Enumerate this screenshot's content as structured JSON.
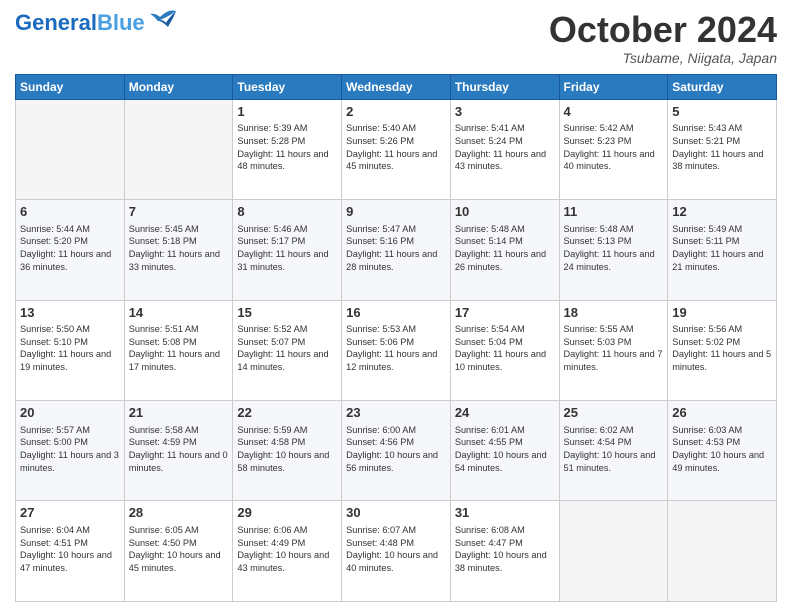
{
  "logo": {
    "part1": "General",
    "part2": "Blue"
  },
  "title": "October 2024",
  "subtitle": "Tsubame, Niigata, Japan",
  "weekdays": [
    "Sunday",
    "Monday",
    "Tuesday",
    "Wednesday",
    "Thursday",
    "Friday",
    "Saturday"
  ],
  "weeks": [
    [
      {
        "day": "",
        "text": ""
      },
      {
        "day": "",
        "text": ""
      },
      {
        "day": "1",
        "text": "Sunrise: 5:39 AM\nSunset: 5:28 PM\nDaylight: 11 hours and 48 minutes."
      },
      {
        "day": "2",
        "text": "Sunrise: 5:40 AM\nSunset: 5:26 PM\nDaylight: 11 hours and 45 minutes."
      },
      {
        "day": "3",
        "text": "Sunrise: 5:41 AM\nSunset: 5:24 PM\nDaylight: 11 hours and 43 minutes."
      },
      {
        "day": "4",
        "text": "Sunrise: 5:42 AM\nSunset: 5:23 PM\nDaylight: 11 hours and 40 minutes."
      },
      {
        "day": "5",
        "text": "Sunrise: 5:43 AM\nSunset: 5:21 PM\nDaylight: 11 hours and 38 minutes."
      }
    ],
    [
      {
        "day": "6",
        "text": "Sunrise: 5:44 AM\nSunset: 5:20 PM\nDaylight: 11 hours and 36 minutes."
      },
      {
        "day": "7",
        "text": "Sunrise: 5:45 AM\nSunset: 5:18 PM\nDaylight: 11 hours and 33 minutes."
      },
      {
        "day": "8",
        "text": "Sunrise: 5:46 AM\nSunset: 5:17 PM\nDaylight: 11 hours and 31 minutes."
      },
      {
        "day": "9",
        "text": "Sunrise: 5:47 AM\nSunset: 5:16 PM\nDaylight: 11 hours and 28 minutes."
      },
      {
        "day": "10",
        "text": "Sunrise: 5:48 AM\nSunset: 5:14 PM\nDaylight: 11 hours and 26 minutes."
      },
      {
        "day": "11",
        "text": "Sunrise: 5:48 AM\nSunset: 5:13 PM\nDaylight: 11 hours and 24 minutes."
      },
      {
        "day": "12",
        "text": "Sunrise: 5:49 AM\nSunset: 5:11 PM\nDaylight: 11 hours and 21 minutes."
      }
    ],
    [
      {
        "day": "13",
        "text": "Sunrise: 5:50 AM\nSunset: 5:10 PM\nDaylight: 11 hours and 19 minutes."
      },
      {
        "day": "14",
        "text": "Sunrise: 5:51 AM\nSunset: 5:08 PM\nDaylight: 11 hours and 17 minutes."
      },
      {
        "day": "15",
        "text": "Sunrise: 5:52 AM\nSunset: 5:07 PM\nDaylight: 11 hours and 14 minutes."
      },
      {
        "day": "16",
        "text": "Sunrise: 5:53 AM\nSunset: 5:06 PM\nDaylight: 11 hours and 12 minutes."
      },
      {
        "day": "17",
        "text": "Sunrise: 5:54 AM\nSunset: 5:04 PM\nDaylight: 11 hours and 10 minutes."
      },
      {
        "day": "18",
        "text": "Sunrise: 5:55 AM\nSunset: 5:03 PM\nDaylight: 11 hours and 7 minutes."
      },
      {
        "day": "19",
        "text": "Sunrise: 5:56 AM\nSunset: 5:02 PM\nDaylight: 11 hours and 5 minutes."
      }
    ],
    [
      {
        "day": "20",
        "text": "Sunrise: 5:57 AM\nSunset: 5:00 PM\nDaylight: 11 hours and 3 minutes."
      },
      {
        "day": "21",
        "text": "Sunrise: 5:58 AM\nSunset: 4:59 PM\nDaylight: 11 hours and 0 minutes."
      },
      {
        "day": "22",
        "text": "Sunrise: 5:59 AM\nSunset: 4:58 PM\nDaylight: 10 hours and 58 minutes."
      },
      {
        "day": "23",
        "text": "Sunrise: 6:00 AM\nSunset: 4:56 PM\nDaylight: 10 hours and 56 minutes."
      },
      {
        "day": "24",
        "text": "Sunrise: 6:01 AM\nSunset: 4:55 PM\nDaylight: 10 hours and 54 minutes."
      },
      {
        "day": "25",
        "text": "Sunrise: 6:02 AM\nSunset: 4:54 PM\nDaylight: 10 hours and 51 minutes."
      },
      {
        "day": "26",
        "text": "Sunrise: 6:03 AM\nSunset: 4:53 PM\nDaylight: 10 hours and 49 minutes."
      }
    ],
    [
      {
        "day": "27",
        "text": "Sunrise: 6:04 AM\nSunset: 4:51 PM\nDaylight: 10 hours and 47 minutes."
      },
      {
        "day": "28",
        "text": "Sunrise: 6:05 AM\nSunset: 4:50 PM\nDaylight: 10 hours and 45 minutes."
      },
      {
        "day": "29",
        "text": "Sunrise: 6:06 AM\nSunset: 4:49 PM\nDaylight: 10 hours and 43 minutes."
      },
      {
        "day": "30",
        "text": "Sunrise: 6:07 AM\nSunset: 4:48 PM\nDaylight: 10 hours and 40 minutes."
      },
      {
        "day": "31",
        "text": "Sunrise: 6:08 AM\nSunset: 4:47 PM\nDaylight: 10 hours and 38 minutes."
      },
      {
        "day": "",
        "text": ""
      },
      {
        "day": "",
        "text": ""
      }
    ]
  ],
  "colors": {
    "header_bg": "#2a7abf",
    "header_text": "#ffffff",
    "accent": "#1a6bbf"
  }
}
